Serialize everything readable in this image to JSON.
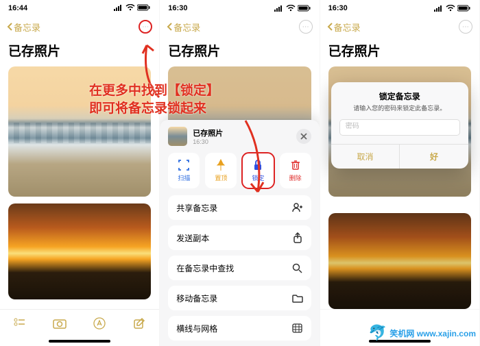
{
  "status": {
    "time1": "16:44",
    "time2": "16:30",
    "time3": "16:30"
  },
  "nav": {
    "back": "备忘录"
  },
  "note": {
    "title": "已存照片"
  },
  "annotation": {
    "line1": "在更多中找到【锁定】",
    "line2": "即可将备忘录锁起来"
  },
  "sheet": {
    "title": "已存照片",
    "subtitle": "16:30",
    "buttons": {
      "scan": "扫描",
      "pin": "置顶",
      "lock": "锁定",
      "delete": "删除"
    },
    "rows": {
      "share": "共享备忘录",
      "send": "发送副本",
      "find": "在备忘录中查找",
      "move": "移动备忘录",
      "lines": "横线与网格"
    }
  },
  "dialog": {
    "title": "锁定备忘录",
    "message": "请输入您的密码来锁定此备忘录。",
    "placeholder": "密码",
    "cancel": "取消",
    "ok": "好"
  },
  "colors": {
    "accent": "#c8a94c",
    "annotation": "#e03020",
    "scan": "#2e6de0",
    "pin": "#e8a01e",
    "lock": "#2e4fe0",
    "delete": "#e0302e"
  },
  "watermark": "笑机网 www.xajin.com"
}
